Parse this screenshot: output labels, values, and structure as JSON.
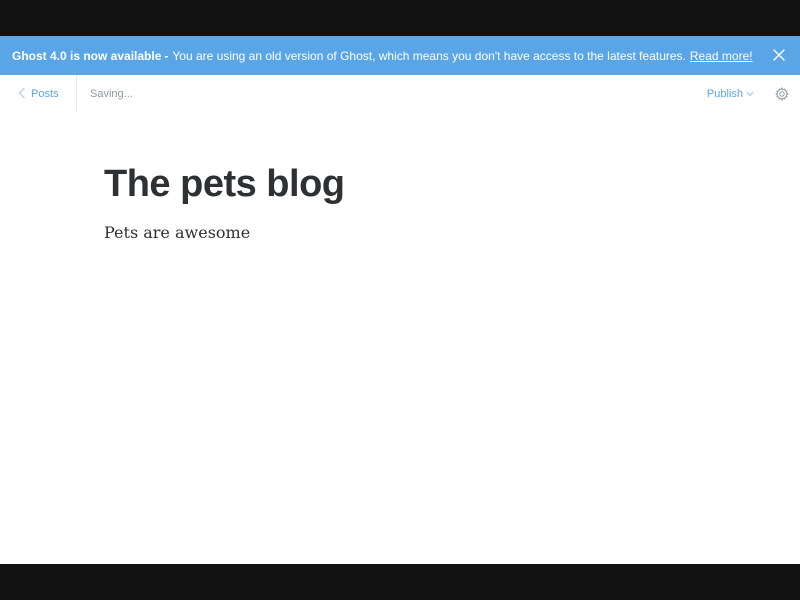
{
  "banner": {
    "headline": "Ghost 4.0 is now available",
    "separator": "-",
    "message": "You are using an old version of Ghost, which means you don't have access to the latest features.",
    "link": "Read more!"
  },
  "header": {
    "back_label": "Posts",
    "status": "Saving...",
    "publish_label": "Publish"
  },
  "post": {
    "title": "The pets blog",
    "body": "Pets are awesome"
  },
  "colors": {
    "accent": "#5aa5e6",
    "text": "#2d3134",
    "muted": "#8e9aa1"
  },
  "icons": {
    "back": "chevron-left-icon",
    "close": "close-icon",
    "publish_dropdown": "chevron-down-icon",
    "settings": "gear-icon"
  }
}
